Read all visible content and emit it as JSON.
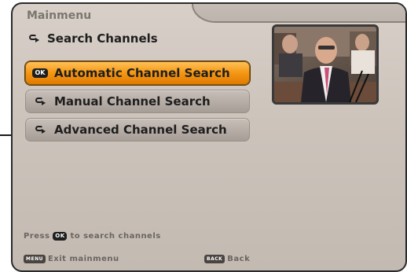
{
  "menu": {
    "title": "Mainmenu",
    "section_title": "Search Channels",
    "section_icon": "sync-icon"
  },
  "buttons": [
    {
      "label": "Automatic Channel Search",
      "icon": "ok-badge",
      "icon_text": "OK",
      "selected": true
    },
    {
      "label": "Manual Channel Search",
      "icon": "sync-icon",
      "selected": false
    },
    {
      "label": "Advanced Channel Search",
      "icon": "sync-icon",
      "selected": false
    }
  ],
  "hint": {
    "prefix": "Press",
    "key": "OK",
    "suffix": "to search channels"
  },
  "footer": {
    "exit_key": "MENU",
    "exit_label": "Exit mainmenu",
    "back_key": "BACK",
    "back_label": "Back"
  },
  "colors": {
    "selected": "#f59a17",
    "panel": "#d8cfc8",
    "text": "#1e1e1e"
  }
}
